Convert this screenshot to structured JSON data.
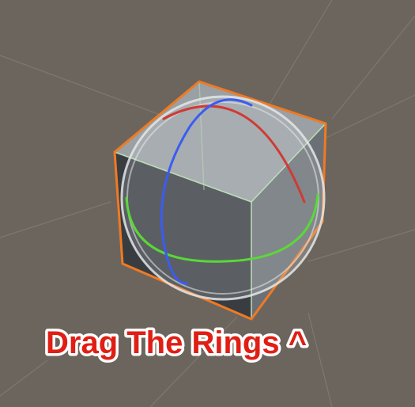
{
  "scene": {
    "background_color": "#6b655e",
    "grid_color": "#807a72",
    "object": "cube",
    "selection_outline_color": "#f07a22",
    "cube_top_color": "#9aa0a4",
    "cube_right_color": "#6b7076",
    "cube_front_color": "#393d42",
    "sphere_color": "#d8dadc",
    "gizmo": {
      "tool": "rotate",
      "rings": [
        {
          "axis": "x",
          "color": "#d03a35"
        },
        {
          "axis": "y",
          "color": "#5ad838"
        },
        {
          "axis": "z",
          "color": "#3a5cf2"
        }
      ]
    }
  },
  "caption": {
    "text": "Drag The Rings ^",
    "fill_color": "#e01e14",
    "outline_color": "#ffffff"
  }
}
